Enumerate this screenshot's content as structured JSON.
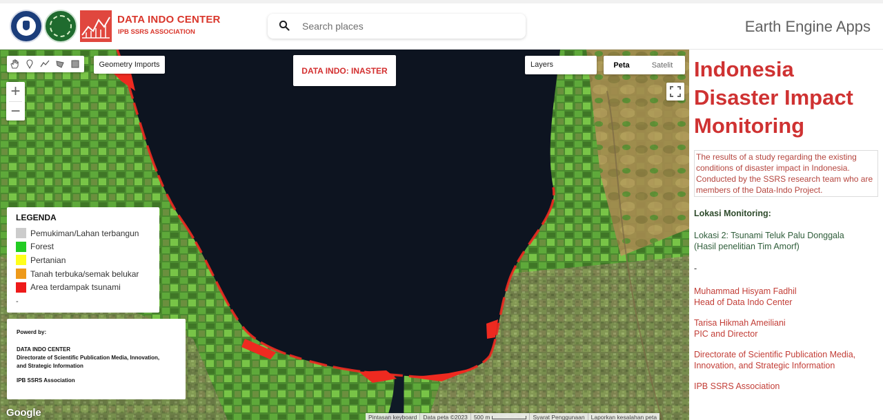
{
  "header": {
    "brand_title": "DATA INDO CENTER",
    "brand_subtitle": "IPB SSRS ASSOCIATION",
    "search_placeholder": "Search places",
    "app_title": "Earth Engine Apps"
  },
  "map": {
    "tools": [
      "hand-icon",
      "point-icon",
      "line-icon",
      "polygon-icon",
      "rectangle-icon"
    ],
    "geometry_imports": "Geometry Imports",
    "zoom_in": "+",
    "zoom_out": "−",
    "title_box": "DATA INDO: INASTER",
    "layers_label": "Layers",
    "map_types": {
      "active": "Peta",
      "inactive": "Satelit"
    },
    "legend": {
      "title": "LEGENDA",
      "items": [
        {
          "label": "Pemukiman/Lahan terbangun",
          "color": "#cccccc"
        },
        {
          "label": "Forest",
          "color": "#22cc22"
        },
        {
          "label": "Pertanian",
          "color": "#ffff1a"
        },
        {
          "label": "Tanah terbuka/semak belukar",
          "color": "#ee9a1a"
        },
        {
          "label": "Area terdampak tsunami",
          "color": "#ee1a1a"
        }
      ],
      "footer": "-"
    },
    "powered": {
      "heading": "Powerd by:",
      "org_name": "DATA INDO CENTER",
      "org_line1": "Directorate of Scientific Publication Media, Innovation,",
      "org_line2": "and Strategic Information",
      "association": "IPB SSRS Association"
    },
    "google_logo": "Google",
    "attribution": {
      "keyboard": "Pintasan keyboard",
      "data": "Data peta ©2023",
      "scale": "500 m",
      "terms": "Syarat Penggunaan",
      "report": "Laporkan kesalahan peta"
    }
  },
  "panel": {
    "title_line1": "Indonesia",
    "title_line2": "Disaster Impact",
    "title_line3": "Monitoring",
    "description": "The results of a study regarding the existing conditions of disaster impact in Indonesia. Conducted by the SSRS research team who are members of the Data-Indo Project.",
    "location_heading": "Lokasi Monitoring:",
    "location_line1": "Lokasi 2: Tsunami Teluk Palu Donggala",
    "location_line2": "(Hasil penelitian Tim Amorf)",
    "separator": "-",
    "contacts": [
      {
        "line1": "Muhammad Hisyam Fadhil",
        "line2": "Head of Data Indo Center"
      },
      {
        "line1": "Tarisa Hikmah Ameiliani",
        "line2": "PIC and Director"
      },
      {
        "line1": "Directorate of Scientific Publication Media,",
        "line2": "Innovation, and Strategic Information"
      },
      {
        "line1": "IPB SSRS Association",
        "line2": ""
      }
    ]
  },
  "colors": {
    "brand_red": "#cf3232",
    "tsunami_red": "#ee1a1a",
    "bay_water": "#0d1420"
  }
}
